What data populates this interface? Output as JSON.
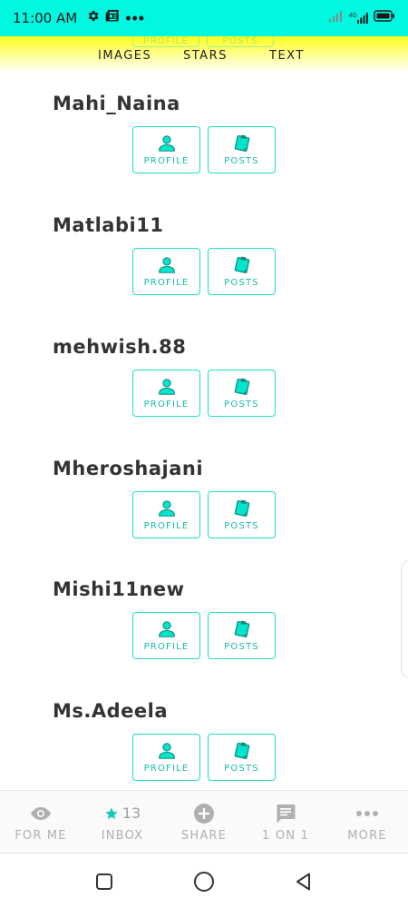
{
  "status_bar": {
    "time": "11:00 AM",
    "network_label": "4G",
    "colors": {
      "background": "#00f7e0"
    }
  },
  "tabs": [
    {
      "label": "IMAGES"
    },
    {
      "label": "STARS"
    },
    {
      "label": "TEXT"
    }
  ],
  "ghost_buttons": {
    "profile": "PROFILE",
    "posts": "POSTS"
  },
  "users": [
    {
      "name": "Mahi_Naina",
      "profile_label": "PROFILE",
      "posts_label": "POSTS"
    },
    {
      "name": "Matlabi11",
      "profile_label": "PROFILE",
      "posts_label": "POSTS"
    },
    {
      "name": "mehwish.88",
      "profile_label": "PROFILE",
      "posts_label": "POSTS"
    },
    {
      "name": "Mheroshajani",
      "profile_label": "PROFILE",
      "posts_label": "POSTS"
    },
    {
      "name": "Mishi11new",
      "profile_label": "PROFILE",
      "posts_label": "POSTS"
    },
    {
      "name": "Ms.Adeela",
      "profile_label": "PROFILE",
      "posts_label": "POSTS"
    }
  ],
  "bottom_nav": [
    {
      "label": "FOR ME",
      "icon": "eye-icon"
    },
    {
      "label": "INBOX",
      "icon": "star-icon",
      "count": "13"
    },
    {
      "label": "SHARE",
      "icon": "plus-circle-icon"
    },
    {
      "label": "1 ON 1",
      "icon": "chat-icon"
    },
    {
      "label": "MORE",
      "icon": "more-dots-icon"
    }
  ],
  "colors": {
    "accent": "#1fe0cc",
    "accent_text": "#19b8ab",
    "icon_fill": "#00e5cc",
    "header_yellow": "#ffff1a"
  }
}
